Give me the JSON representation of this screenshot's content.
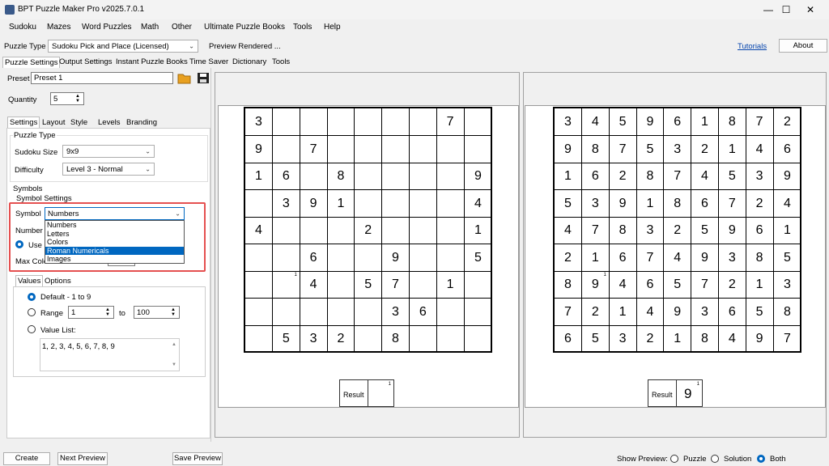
{
  "window": {
    "title": "BPT Puzzle Maker Pro v2025.7.0.1",
    "minimize": "—",
    "maximize": "☐",
    "close": "✕"
  },
  "menu": [
    "Sudoku",
    "Mazes",
    "Word Puzzles",
    "Math",
    "Other",
    "Ultimate Puzzle Books",
    "Tools",
    "Help"
  ],
  "toolbar": {
    "puzzle_type_label": "Puzzle Type",
    "puzzle_type_value": "Sudoku Pick and Place (Licensed)",
    "status": "Preview Rendered ...",
    "tutorials": "Tutorials",
    "about": "About"
  },
  "main_tabs": [
    "Puzzle Settings",
    "Output Settings",
    "Instant Puzzle Books",
    "Time Saver",
    "Dictionary",
    "Tools"
  ],
  "settings": {
    "preset_label": "Preset",
    "preset_value": "Preset 1",
    "quantity_label": "Quantity",
    "quantity_value": "5",
    "sub_tabs": [
      "Settings",
      "Layout",
      "Style",
      "Levels",
      "Branding"
    ],
    "puzzle_type_group": "Puzzle Type",
    "sudoku_size_label": "Sudoku Size",
    "sudoku_size_value": "9x9",
    "difficulty_label": "Difficulty",
    "difficulty_value": "Level 3 - Normal",
    "symbols_group": "Symbols",
    "symbol_settings_label": "Symbol Settings",
    "symbol_label": "Symbol",
    "symbol_value": "Numbers",
    "symbol_options": [
      "Numbers",
      "Letters",
      "Colors",
      "Roman Numericals",
      "Images"
    ],
    "number_of_label": "Number o",
    "use_label": "Use F",
    "max_color_label": "Max Colo",
    "value_tabs": [
      "Values",
      "Options"
    ],
    "default_label": "Default - 1 to 9",
    "range_label": "Range",
    "range_from": "1",
    "range_to_label": "to",
    "range_to": "100",
    "value_list_label": "Value List:",
    "value_list": "1, 2, 3, 4, 5, 6, 7, 8, 9"
  },
  "puzzle": {
    "cells": [
      [
        "3",
        "",
        "",
        "",
        "",
        "",
        "",
        "7",
        ""
      ],
      [
        "9",
        "",
        "7",
        "",
        "",
        "",
        "",
        "",
        ""
      ],
      [
        "1",
        "6",
        "",
        "8",
        "",
        "",
        "",
        "",
        "9"
      ],
      [
        "",
        "3",
        "9",
        "1",
        "",
        "",
        "",
        "",
        "4"
      ],
      [
        "4",
        "",
        "",
        "",
        "2",
        "",
        "",
        "",
        "1"
      ],
      [
        "",
        "",
        "6",
        "",
        "",
        "9",
        "",
        "",
        "5"
      ],
      [
        "",
        "",
        "4",
        "",
        "5",
        "7",
        "",
        "1",
        ""
      ],
      [
        "",
        "",
        "",
        "",
        "",
        "3",
        "6",
        "",
        ""
      ],
      [
        "",
        "5",
        "3",
        "2",
        "",
        "8",
        "",
        "",
        ""
      ]
    ],
    "note_cell_label": "1",
    "result_label": "Result",
    "result_note": "1"
  },
  "solution": {
    "cells": [
      [
        "3",
        "4",
        "5",
        "9",
        "6",
        "1",
        "8",
        "7",
        "2"
      ],
      [
        "9",
        "8",
        "7",
        "5",
        "3",
        "2",
        "1",
        "4",
        "6"
      ],
      [
        "1",
        "6",
        "2",
        "8",
        "7",
        "4",
        "5",
        "3",
        "9"
      ],
      [
        "5",
        "3",
        "9",
        "1",
        "8",
        "6",
        "7",
        "2",
        "4"
      ],
      [
        "4",
        "7",
        "8",
        "3",
        "2",
        "5",
        "9",
        "6",
        "1"
      ],
      [
        "2",
        "1",
        "6",
        "7",
        "4",
        "9",
        "3",
        "8",
        "5"
      ],
      [
        "8",
        "9",
        "4",
        "6",
        "5",
        "7",
        "2",
        "1",
        "3"
      ],
      [
        "7",
        "2",
        "1",
        "4",
        "9",
        "3",
        "6",
        "5",
        "8"
      ],
      [
        "6",
        "5",
        "3",
        "2",
        "1",
        "8",
        "4",
        "9",
        "7"
      ]
    ],
    "note_cell_label": "1",
    "result_label": "Result",
    "result_value": "9",
    "result_note": "1"
  },
  "bottom": {
    "create": "Create",
    "next_preview": "Next Preview",
    "save_preview": "Save Preview",
    "show_preview_label": "Show Preview:",
    "opt_puzzle": "Puzzle",
    "opt_solution": "Solution",
    "opt_both": "Both"
  },
  "colors": {
    "accent": "#0067c0",
    "highlight": "#e55050",
    "link": "#0645ad"
  }
}
